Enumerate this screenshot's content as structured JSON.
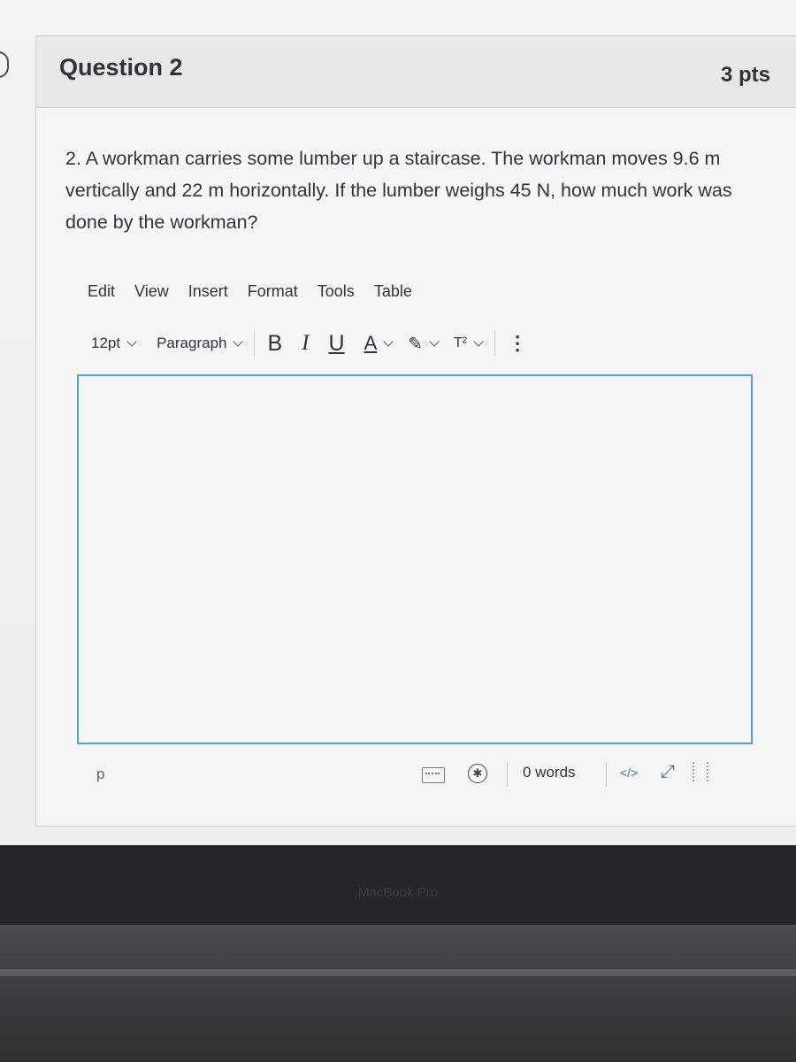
{
  "question": {
    "title": "Question 2",
    "points": "3 pts",
    "text": "2. A workman carries some lumber up a staircase. The workman moves 9.6 m vertically and 22 m horizontally. If the lumber weighs 45 N, how much work was done by the workman?"
  },
  "editor": {
    "menu": [
      "Edit",
      "View",
      "Insert",
      "Format",
      "Tools",
      "Table"
    ],
    "font_size": "12pt",
    "block_format": "Paragraph",
    "format_buttons": {
      "bold": "B",
      "italic": "I",
      "underline": "U",
      "text_color": "A",
      "superscript": "T²"
    },
    "content": "",
    "path": "p",
    "word_count": "0 words",
    "html_toggle": "</>"
  },
  "device": {
    "label": "MacBook Pro"
  },
  "colors": {
    "focus_border": "#5b9bd5"
  }
}
